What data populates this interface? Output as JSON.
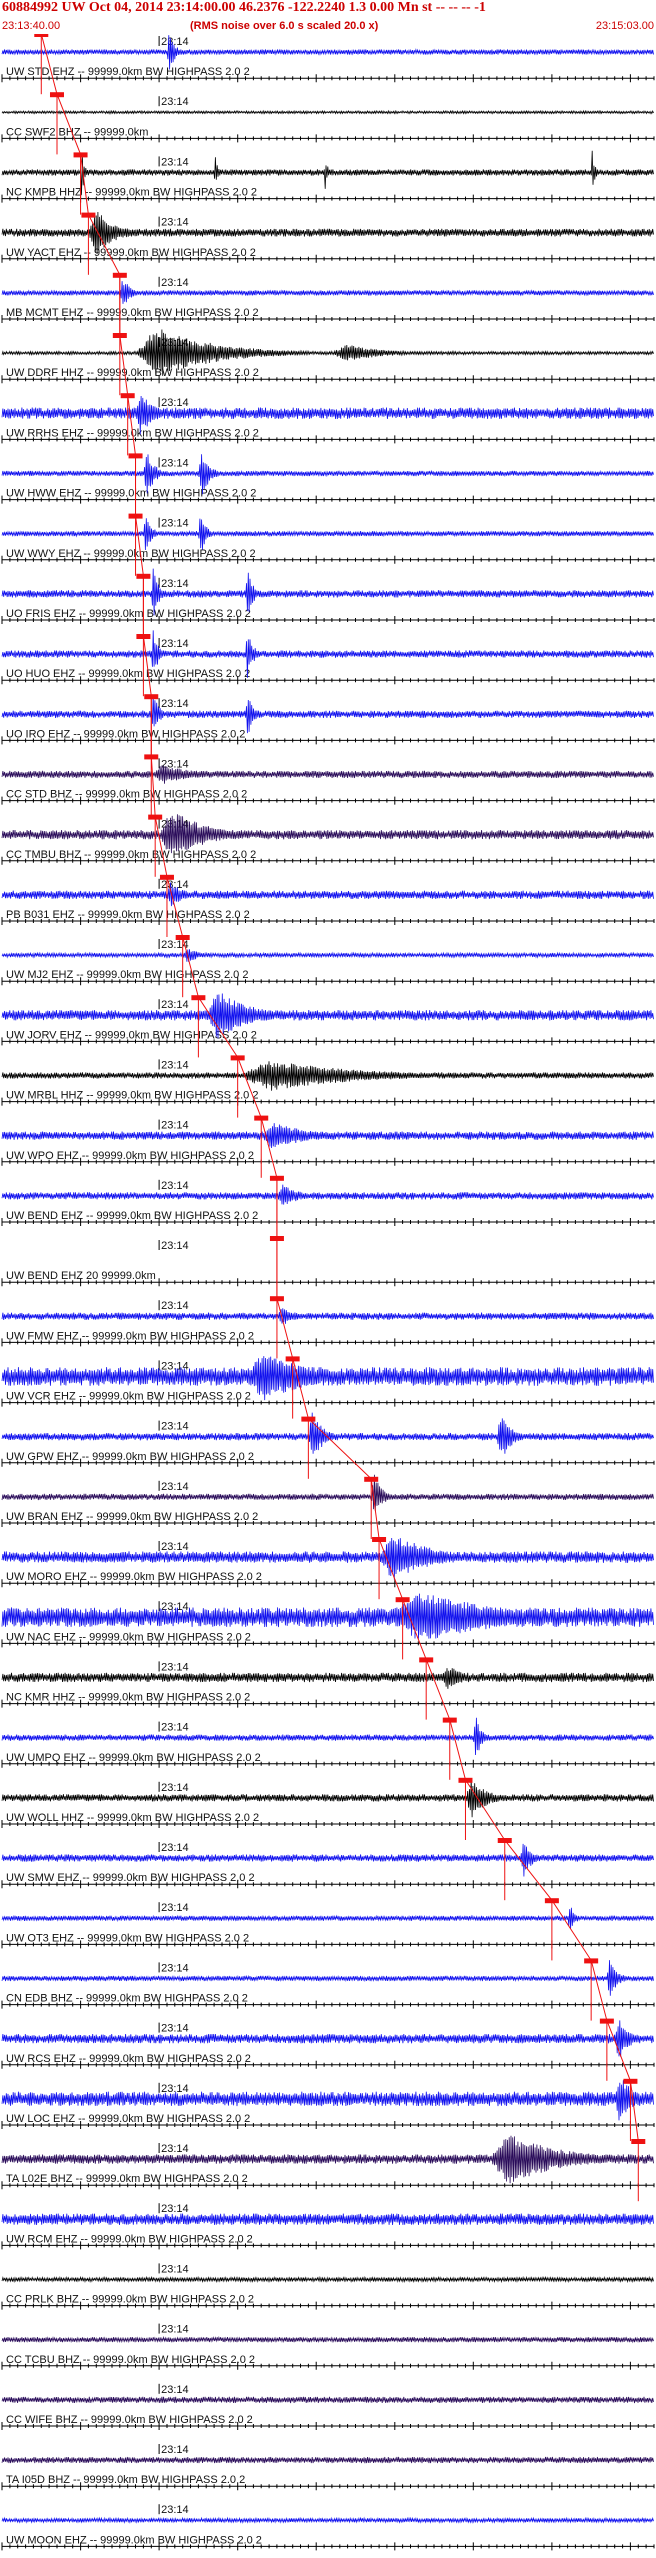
{
  "header": {
    "title": "60884992 UW Oct 04, 2014 23:14:00.00   46.2376 -122.2240  1.3 0.00 Mn st -- -- --  -1",
    "start_time": "23:13:40.00",
    "end_time": "23:15:03.00",
    "rms_note": "(RMS noise over 6.0 s scaled 20.0 x)"
  },
  "colors": {
    "blue": "#1010ee",
    "black": "#000000",
    "purple": "#2a0c5a",
    "pick": "#ee1111",
    "grid": "#000000"
  },
  "chart_data": {
    "type": "seismogram",
    "x_unit": "seconds after 23:13:40.00",
    "x_range": [
      0,
      83
    ],
    "minute_mark": {
      "time_s": 20,
      "label": "23:14"
    },
    "rows": [
      {
        "label": "UW STD EHZ -- 99999.0km BW  HIGHPASS  2.0  2",
        "color": "blue",
        "pick_s": 5.0,
        "noise": 0.1,
        "bursts": [
          {
            "t": 21,
            "dur": 2,
            "amp": 0.9
          }
        ]
      },
      {
        "label": "CC SWF2 BHZ -- 99999.0km",
        "color": "black",
        "pick_s": 7.0,
        "noise": 0.05,
        "bursts": []
      },
      {
        "label": "NC KMPB HHZ -- 99999.0km BW  HIGHPASS  2.0  2",
        "color": "black",
        "pick_s": 10.0,
        "noise": 0.12,
        "bursts": [
          {
            "t": 10,
            "dur": 1,
            "amp": 1.0
          },
          {
            "t": 27,
            "dur": 1,
            "amp": 0.7
          },
          {
            "t": 41,
            "dur": 1,
            "amp": 0.7
          },
          {
            "t": 75,
            "dur": 1,
            "amp": 0.9
          }
        ]
      },
      {
        "label": "UW YACT EHZ -- 99999.0km BW  HIGHPASS  2.0  2",
        "color": "black",
        "pick_s": 11.0,
        "noise": 0.15,
        "bursts": [
          {
            "t": 11,
            "dur": 7,
            "amp": 1.0
          }
        ]
      },
      {
        "label": "MB MCMT EHZ -- 99999.0km BW  HIGHPASS  2.0  2",
        "color": "blue",
        "pick_s": 15.0,
        "noise": 0.1,
        "bursts": [
          {
            "t": 15,
            "dur": 3,
            "amp": 0.6
          }
        ]
      },
      {
        "label": "UW DDRF HHZ -- 99999.0km BW  HIGHPASS  2.0  2",
        "color": "black",
        "pick_s": 15.0,
        "noise": 0.06,
        "bursts": [
          {
            "t": 17,
            "dur": 22,
            "amp": 1.0
          },
          {
            "t": 42,
            "dur": 14,
            "amp": 0.35
          }
        ]
      },
      {
        "label": "UW RRHS EHZ -- 99999.0km BW  HIGHPASS  2.0  2",
        "color": "blue",
        "pick_s": 16.0,
        "noise": 0.22,
        "bursts": [
          {
            "t": 17,
            "dur": 5,
            "amp": 0.9
          }
        ]
      },
      {
        "label": "UW HWW EHZ -- 99999.0km BW  HIGHPASS  2.0  2",
        "color": "blue",
        "pick_s": 17.0,
        "noise": 0.1,
        "bursts": [
          {
            "t": 18,
            "dur": 3,
            "amp": 1.0
          },
          {
            "t": 25,
            "dur": 3,
            "amp": 1.0
          }
        ]
      },
      {
        "label": "UW WWY EHZ -- 99999.0km BW  HIGHPASS  2.0  2",
        "color": "blue",
        "pick_s": 17.0,
        "noise": 0.1,
        "bursts": [
          {
            "t": 18,
            "dur": 2,
            "amp": 1.0
          },
          {
            "t": 25,
            "dur": 2,
            "amp": 1.0
          }
        ]
      },
      {
        "label": "UO FRIS EHZ -- 99999.0km BW  HIGHPASS  2.0  2",
        "color": "blue",
        "pick_s": 18.0,
        "noise": 0.14,
        "bursts": [
          {
            "t": 19,
            "dur": 2,
            "amp": 1.0
          },
          {
            "t": 31,
            "dur": 2,
            "amp": 1.0
          }
        ]
      },
      {
        "label": "UO HUO EHZ -- 99999.0km BW  HIGHPASS  2.0  2",
        "color": "blue",
        "pick_s": 18.0,
        "noise": 0.14,
        "bursts": [
          {
            "t": 19,
            "dur": 2,
            "amp": 1.0
          },
          {
            "t": 31,
            "dur": 2,
            "amp": 1.0
          }
        ]
      },
      {
        "label": "UO IRO EHZ -- 99999.0km BW  HIGHPASS  2.0  2",
        "color": "blue",
        "pick_s": 19.0,
        "noise": 0.14,
        "bursts": [
          {
            "t": 19,
            "dur": 2,
            "amp": 1.0
          },
          {
            "t": 31,
            "dur": 2,
            "amp": 1.0
          }
        ]
      },
      {
        "label": "CC STD BHZ -- 99999.0km BW  HIGHPASS  2.0  2",
        "color": "purple",
        "pick_s": 19.0,
        "noise": 0.14,
        "bursts": [
          {
            "t": 19,
            "dur": 12,
            "amp": 0.4
          }
        ]
      },
      {
        "label": "CC TMBU BHZ -- 99999.0km BW  HIGHPASS  2.0  2",
        "color": "purple",
        "pick_s": 19.5,
        "noise": 0.18,
        "bursts": [
          {
            "t": 20,
            "dur": 13,
            "amp": 1.0
          }
        ]
      },
      {
        "label": "PB B031 EHZ -- 99999.0km BW  HIGHPASS  2.0  2",
        "color": "blue",
        "pick_s": 21.0,
        "noise": 0.16,
        "bursts": [
          {
            "t": 21,
            "dur": 4,
            "amp": 0.6
          }
        ]
      },
      {
        "label": "UW MJ2 EHZ -- 99999.0km BW  HIGHPASS  2.0  2",
        "color": "blue",
        "pick_s": 23.0,
        "noise": 0.08,
        "bursts": [
          {
            "t": 23,
            "dur": 5,
            "amp": 0.3
          }
        ]
      },
      {
        "label": "UW JORV EHZ -- 99999.0km BW  HIGHPASS  2.0  2",
        "color": "blue",
        "pick_s": 25.0,
        "noise": 0.2,
        "bursts": [
          {
            "t": 26,
            "dur": 12,
            "amp": 1.0
          }
        ]
      },
      {
        "label": "UW MRBL HHZ -- 99999.0km BW  HIGHPASS  2.0  2",
        "color": "black",
        "pick_s": 30.0,
        "noise": 0.12,
        "bursts": [
          {
            "t": 30,
            "dur": 34,
            "amp": 0.6
          }
        ]
      },
      {
        "label": "UW WPO EHZ -- 99999.0km BW  HIGHPASS  2.0  2",
        "color": "blue",
        "pick_s": 33.0,
        "noise": 0.16,
        "bursts": [
          {
            "t": 33,
            "dur": 12,
            "amp": 0.6
          }
        ]
      },
      {
        "label": "UW BEND EHZ -- 99999.0km BW  HIGHPASS  2.0  2",
        "color": "blue",
        "pick_s": 35.0,
        "noise": 0.14,
        "bursts": [
          {
            "t": 35,
            "dur": 6,
            "amp": 0.5
          }
        ]
      },
      {
        "label": "UW BEND EHZ 20 99999.0km",
        "color": "blue",
        "pick_s": 35.0,
        "noise": 0.0,
        "bursts": []
      },
      {
        "label": "UW FMW EHZ -- 99999.0km BW  HIGHPASS  2.0  2",
        "color": "blue",
        "pick_s": 35.0,
        "noise": 0.14,
        "bursts": [
          {
            "t": 35,
            "dur": 5,
            "amp": 0.4
          }
        ]
      },
      {
        "label": "UW VCR EHZ -- 99999.0km BW  HIGHPASS  2.0  2",
        "color": "blue",
        "pick_s": 37.0,
        "noise": 0.36,
        "bursts": [
          {
            "t": 31,
            "dur": 18,
            "amp": 1.0
          }
        ]
      },
      {
        "label": "UW GPW EHZ -- 99999.0km BW  HIGHPASS  2.0  2",
        "color": "blue",
        "pick_s": 39.0,
        "noise": 0.14,
        "bursts": [
          {
            "t": 39,
            "dur": 4,
            "amp": 1.0
          },
          {
            "t": 63,
            "dur": 4,
            "amp": 1.0
          }
        ]
      },
      {
        "label": "UW BRAN EHZ -- 99999.0km BW  HIGHPASS  2.0  2",
        "color": "purple",
        "pick_s": 47.0,
        "noise": 0.12,
        "bursts": [
          {
            "t": 47,
            "dur": 3,
            "amp": 0.9
          }
        ]
      },
      {
        "label": "UW MORO EHZ -- 99999.0km BW  HIGHPASS  2.0  2",
        "color": "blue",
        "pick_s": 48.0,
        "noise": 0.22,
        "bursts": [
          {
            "t": 48,
            "dur": 14,
            "amp": 1.0
          }
        ]
      },
      {
        "label": "UW NAC EHZ -- 99999.0km BW  HIGHPASS  2.0  2",
        "color": "blue",
        "pick_s": 51.0,
        "noise": 0.38,
        "bursts": [
          {
            "t": 49,
            "dur": 34,
            "amp": 1.0
          }
        ]
      },
      {
        "label": "NC KMR HHZ -- 99999.0km BW  HIGHPASS  2.0  2",
        "color": "black",
        "pick_s": 54.0,
        "noise": 0.18,
        "bursts": [
          {
            "t": 56,
            "dur": 6,
            "amp": 0.5
          }
        ]
      },
      {
        "label": "UW UMPQ EHZ -- 99999.0km BW  HIGHPASS  2.0  2",
        "color": "blue",
        "pick_s": 57.0,
        "noise": 0.12,
        "bursts": [
          {
            "t": 60,
            "dur": 2,
            "amp": 1.0
          }
        ]
      },
      {
        "label": "UW WOLL HHZ -- 99999.0km BW  HIGHPASS  2.0  2",
        "color": "black",
        "pick_s": 59.0,
        "noise": 0.14,
        "bursts": [
          {
            "t": 59,
            "dur": 6,
            "amp": 0.8
          }
        ]
      },
      {
        "label": "UW SMW EHZ -- 99999.0km BW  HIGHPASS  2.0  2",
        "color": "blue",
        "pick_s": 64.0,
        "noise": 0.14,
        "bursts": [
          {
            "t": 66,
            "dur": 3,
            "amp": 0.8
          }
        ]
      },
      {
        "label": "UW OT3 EHZ -- 99999.0km BW  HIGHPASS  2.0  2",
        "color": "blue",
        "pick_s": 70.0,
        "noise": 0.1,
        "bursts": [
          {
            "t": 72,
            "dur": 2,
            "amp": 0.6
          }
        ]
      },
      {
        "label": "CN EDB BHZ -- 99999.0km BW  HIGHPASS  2.0  2",
        "color": "blue",
        "pick_s": 75.0,
        "noise": 0.1,
        "bursts": [
          {
            "t": 77,
            "dur": 3,
            "amp": 0.8
          }
        ]
      },
      {
        "label": "UW RCS EHZ -- 99999.0km BW  HIGHPASS  2.0  2",
        "color": "blue",
        "pick_s": 77.0,
        "noise": 0.18,
        "bursts": [
          {
            "t": 78,
            "dur": 4,
            "amp": 0.9
          }
        ]
      },
      {
        "label": "UW LOC EHZ -- 99999.0km BW  HIGHPASS  2.0  2",
        "color": "blue",
        "pick_s": 80.0,
        "noise": 0.28,
        "bursts": [
          {
            "t": 78,
            "dur": 5,
            "amp": 1.0
          }
        ]
      },
      {
        "label": "TA L02E BHZ -- 99999.0km BW  HIGHPASS  2.0  2",
        "color": "purple",
        "pick_s": 81.0,
        "noise": 0.18,
        "bursts": [
          {
            "t": 62,
            "dur": 20,
            "amp": 1.0
          }
        ]
      },
      {
        "label": "UW RCM EHZ -- 99999.0km BW  HIGHPASS  2.0  2",
        "color": "blue",
        "pick_s": null,
        "noise": 0.22,
        "bursts": []
      },
      {
        "label": "CC PRLK BHZ -- 99999.0km BW  HIGHPASS  2.0  2",
        "color": "black",
        "pick_s": null,
        "noise": 0.08,
        "bursts": []
      },
      {
        "label": "CC TCBU BHZ -- 99999.0km BW  HIGHPASS  2.0  2",
        "color": "purple",
        "pick_s": null,
        "noise": 0.1,
        "bursts": []
      },
      {
        "label": "CC WIFE BHZ -- 99999.0km BW  HIGHPASS  2.0  2",
        "color": "purple",
        "pick_s": null,
        "noise": 0.12,
        "bursts": []
      },
      {
        "label": "TA I05D BHZ -- 99999.0km BW  HIGHPASS  2.0  2",
        "color": "purple",
        "pick_s": null,
        "noise": 0.12,
        "bursts": []
      },
      {
        "label": "UW MOON EHZ -- 99999.0km BW  HIGHPASS  2.0  2",
        "color": "blue",
        "pick_s": null,
        "noise": 0.08,
        "bursts": []
      }
    ]
  }
}
